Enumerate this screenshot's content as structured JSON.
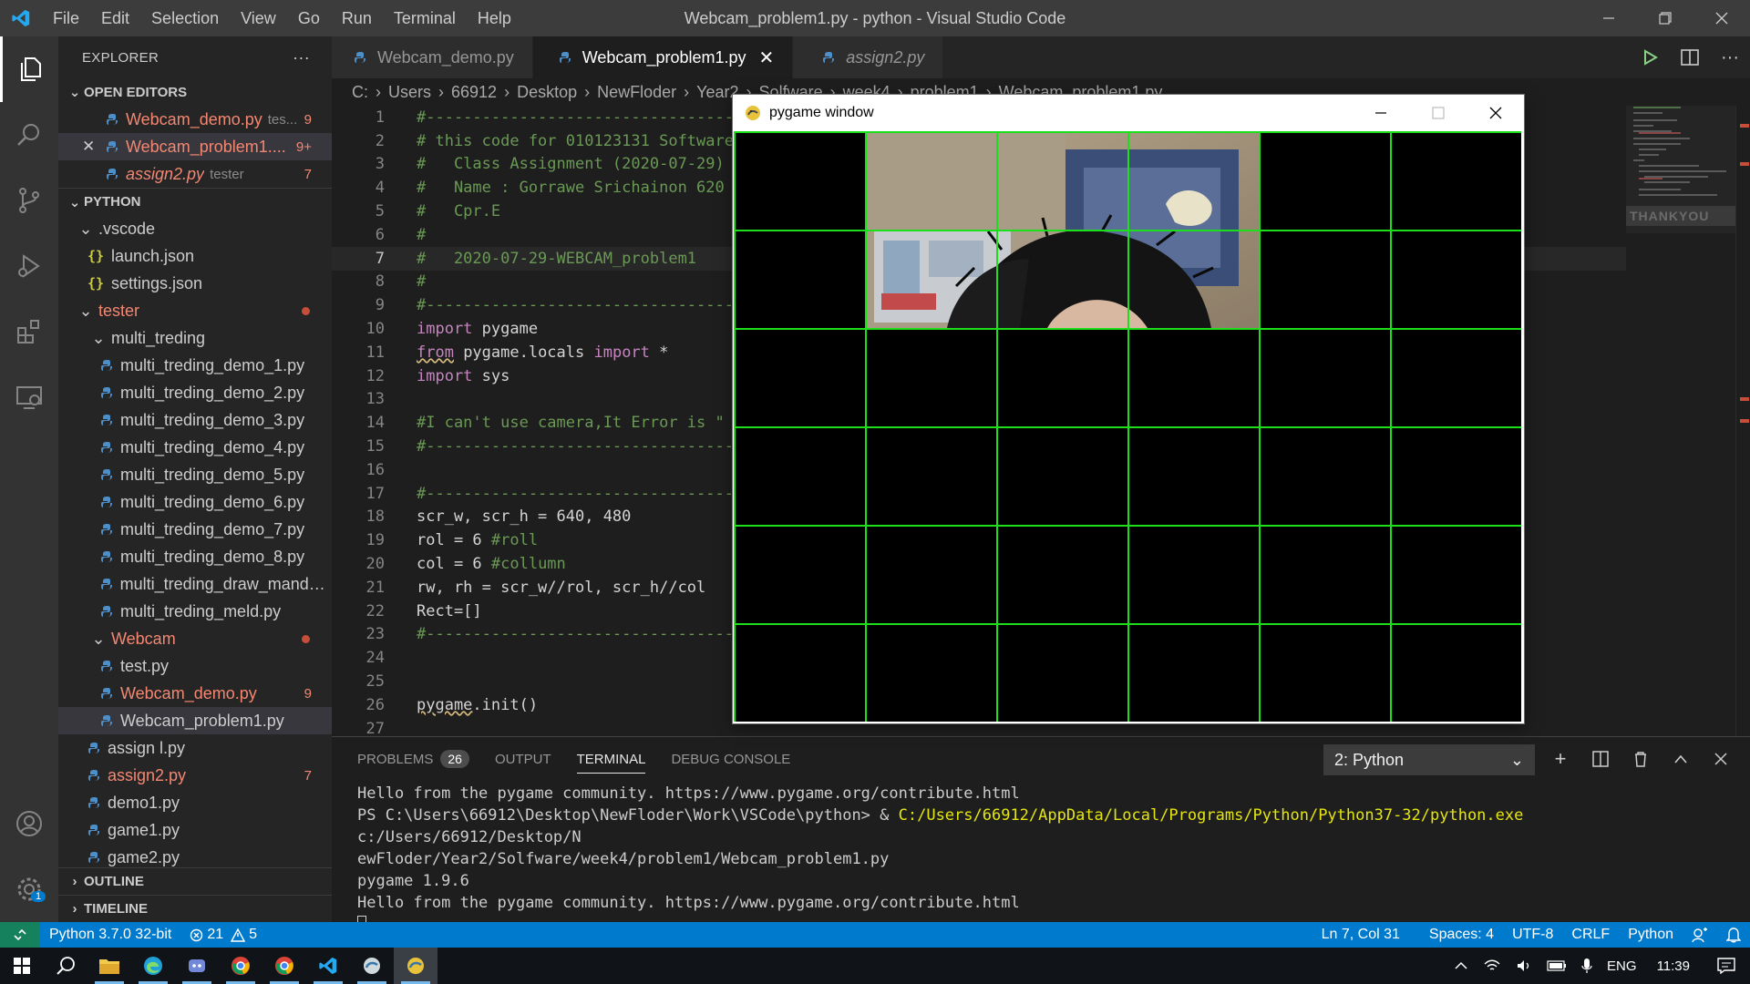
{
  "titlebar": {
    "menu": [
      "File",
      "Edit",
      "Selection",
      "View",
      "Go",
      "Run",
      "Terminal",
      "Help"
    ],
    "title": "Webcam_problem1.py - python - Visual Studio Code"
  },
  "sidebar": {
    "header": "EXPLORER",
    "more": "···",
    "open_editors_label": "OPEN EDITORS",
    "open_editors": [
      {
        "name": "Webcam_demo.py",
        "desc": "tes...",
        "badge": "9"
      },
      {
        "name": "Webcam_problem1....",
        "badge": "9+"
      },
      {
        "name": "assign2.py",
        "desc": "tester",
        "badge": "7"
      }
    ],
    "python_label": "PYTHON",
    "tree": {
      "vscode": ".vscode",
      "launch": "launch.json",
      "settings": "settings.json",
      "tester": "tester",
      "multi_treding": "multi_treding",
      "multi_files": [
        "multi_treding_demo_1.py",
        "multi_treding_demo_2.py",
        "multi_treding_demo_3.py",
        "multi_treding_demo_4.py",
        "multi_treding_demo_5.py",
        "multi_treding_demo_6.py",
        "multi_treding_demo_7.py",
        "multi_treding_demo_8.py",
        "multi_treding_draw_mandel...",
        "multi_treding_meld.py"
      ],
      "webcam": "Webcam",
      "test": "test.py",
      "webcam_demo": "Webcam_demo.py",
      "webcam_demo_badge": "9",
      "webcam_problem1": "Webcam_problem1.py",
      "assign1": "assign l.py",
      "assign2": "assign2.py",
      "assign2_badge": "7",
      "demo1": "demo1.py",
      "game1": "game1.py",
      "game2": "game2.py"
    },
    "outline_label": "OUTLINE",
    "timeline_label": "TIMELINE"
  },
  "tabs": [
    {
      "label": "Webcam_demo.py"
    },
    {
      "label": "Webcam_problem1.py"
    },
    {
      "label": "assign2.py"
    }
  ],
  "breadcrumb": [
    "C:",
    "Users",
    "66912",
    "Desktop",
    "NewFloder",
    "Year2",
    "Solfware",
    "week4",
    "problem1",
    "Webcam_problem1.py"
  ],
  "code": {
    "l1": "#---------------------------------------",
    "l2": "# this code for 010123131 Software",
    "l3": "#   Class Assignment (2020-07-29)",
    "l4": "#   Name : Gorrawe Srichainon 620",
    "l5": "#   Cpr.E",
    "l6": "#",
    "l7": "#   2020-07-29-WEBCAM_problem1",
    "l8": "#",
    "l9": "#---------------------------------------",
    "l10_kw": "import",
    "l10_rest": " pygame",
    "l11_kw": "from",
    "l11_mid": " pygame.locals ",
    "l11_kw2": "import",
    "l11_rest": " *",
    "l12_kw": "import",
    "l12_rest": " sys",
    "l14": "#I can't use camera,It Error is \"",
    "l15": "#---------------------------------------",
    "l17": "#---------------------------------------",
    "l18": "scr_w, scr_h = 640, 480",
    "l19_code": "rol = 6 ",
    "l19_cm": "#roll",
    "l20_code": "col = 6 ",
    "l20_cm": "#collumn",
    "l21": "rw, rh = scr_w//rol, scr_h//col",
    "l22": "Rect=[]",
    "l23": "#---------------------------------------",
    "l26_a": "pygame",
    "l26_b": ".init()"
  },
  "pygame": {
    "title": "pygame window"
  },
  "panel": {
    "problems": "PROBLEMS",
    "problems_count": "26",
    "output": "OUTPUT",
    "terminal": "TERMINAL",
    "debug": "DEBUG CONSOLE",
    "term_select": "2: Python",
    "lines": {
      "t1": "Hello from the pygame community. https://www.pygame.org/contribute.html",
      "t2a": "PS C:\\Users\\66912\\Desktop\\NewFloder\\Work\\VSCode\\python> & ",
      "t2b": "C:/Users/66912/AppData/Local/Programs/Python/Python37-32/python.exe",
      "t2c": " c:/Users/66912/Desktop/N",
      "t3": "ewFloder/Year2/Solfware/week4/problem1/Webcam_problem1.py",
      "t4": "pygame 1.9.6",
      "t5": "Hello from the pygame community. https://www.pygame.org/contribute.html"
    }
  },
  "statusbar": {
    "python": "Python 3.7.0 32-bit",
    "errors": "21",
    "warnings": "5",
    "position": "Ln 7, Col 31",
    "spaces": "Spaces: 4",
    "encoding": "UTF-8",
    "eol": "CRLF",
    "language": "Python",
    "settings_badge": "1"
  },
  "taskbar": {
    "lang": "ENG",
    "time": "11:39"
  },
  "colors": {
    "accent": "#007acc",
    "grid": "#1adf1a",
    "error": "#f48771"
  }
}
